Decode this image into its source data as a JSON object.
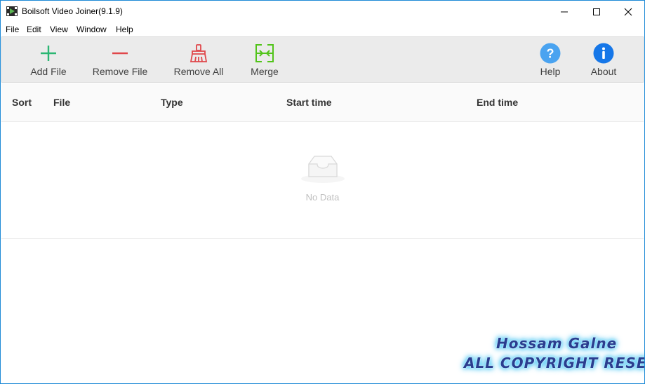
{
  "window": {
    "title": "Boilsoft Video Joiner(9.1.9)"
  },
  "menu": [
    "File",
    "Edit",
    "View",
    "Window",
    "Help"
  ],
  "toolbar": {
    "add_file": "Add File",
    "remove_file": "Remove File",
    "remove_all": "Remove All",
    "merge": "Merge",
    "help": "Help",
    "about": "About"
  },
  "table": {
    "columns": [
      "Sort",
      "File",
      "Type",
      "Start time",
      "End time"
    ],
    "rows": [],
    "empty_text": "No Data"
  },
  "watermark": {
    "line1": "Hossam Galne",
    "line2": "ALL COPYRIGHT RESERVED"
  },
  "colors": {
    "add": "#2bb673",
    "remove": "#e0474b",
    "remove_all": "#e0474b",
    "merge": "#52c41a",
    "help": "#4aa3f0",
    "about": "#1677e8",
    "window_border": "#1e8ad6"
  },
  "icons": {
    "add_file": "plus-icon",
    "remove_file": "minus-icon",
    "remove_all": "broom-icon",
    "merge": "merge-icon",
    "help": "question-icon",
    "about": "info-icon",
    "empty": "inbox-icon"
  }
}
